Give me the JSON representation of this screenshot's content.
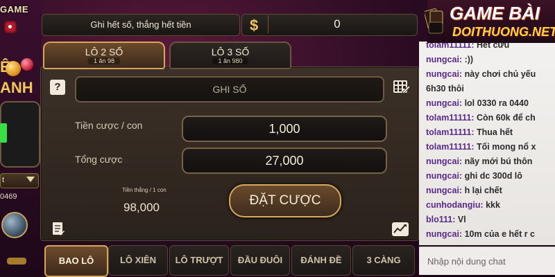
{
  "left_decor": {
    "logo_text": "GAME",
    "partial_word_a": "Ê",
    "partial_word_b": "ANH",
    "dropdown_text": "t",
    "number_fragment": "0469"
  },
  "header": {
    "slogan": "Ghi hết số, thắng hết tiền",
    "currency_symbol": "$",
    "balance": "0"
  },
  "mode_tabs": [
    {
      "label": "LÔ 2 SỐ",
      "sub": "1 ăn 98",
      "active": true
    },
    {
      "label": "LÔ 3 SỐ",
      "sub": "1 ăn 980",
      "active": false
    }
  ],
  "form": {
    "ghi_so_placeholder": "GHI SỐ",
    "bet_per_label": "Tiền cược / con",
    "bet_per_value": "1,000",
    "total_label": "Tổng cược",
    "total_value": "27,000",
    "win_label": "Tiền thắng / 1 con",
    "win_value": "98,000",
    "place_bet_button": "ĐẶT CƯỢC"
  },
  "bottom_tabs": [
    {
      "label": "BAO LÔ",
      "active": true
    },
    {
      "label": "LÔ XIÊN",
      "active": false
    },
    {
      "label": "LÔ TRƯỢT",
      "active": false
    },
    {
      "label": "ĐẦU ĐUÔI",
      "active": false
    },
    {
      "label": "ĐÁNH ĐỀ",
      "active": false
    },
    {
      "label": "3 CÀNG",
      "active": false
    }
  ],
  "brand": {
    "top": "GAME BÀI",
    "bottom": "DOITHUONG.NET"
  },
  "chat": {
    "messages": [
      {
        "user": "tolam11111:",
        "text": " Hết cứu"
      },
      {
        "user": "nungcai:",
        "text": " :))"
      },
      {
        "user": "nungcai:",
        "text": " này chơi chủ yếu"
      },
      {
        "user": "",
        "text": "6h30 thôi"
      },
      {
        "user": "nungcai:",
        "text": " lol 0330 ra 0440"
      },
      {
        "user": "tolam11111:",
        "text": " Còn 60k để ch"
      },
      {
        "user": "tolam11111:",
        "text": " Thua hết"
      },
      {
        "user": "tolam11111:",
        "text": " Tối mong nổ x"
      },
      {
        "user": "nungcai:",
        "text": " nãy mới bú thôn"
      },
      {
        "user": "nungcai:",
        "text": " ghi dc 300d lô"
      },
      {
        "user": "nungcai:",
        "text": " h lại chết"
      },
      {
        "user": "cunhodangiu:",
        "text": " kkk"
      },
      {
        "user": "blo111:",
        "text": " Vl"
      },
      {
        "user": "nungcai:",
        "text": " 10m của e hết r c"
      }
    ],
    "input_placeholder": "Nhập nội dung chat"
  },
  "colors": {
    "gold_border": "#d8a65a",
    "chat_user": "#5a2a8a",
    "brand_yellow": "#ffd63a"
  }
}
